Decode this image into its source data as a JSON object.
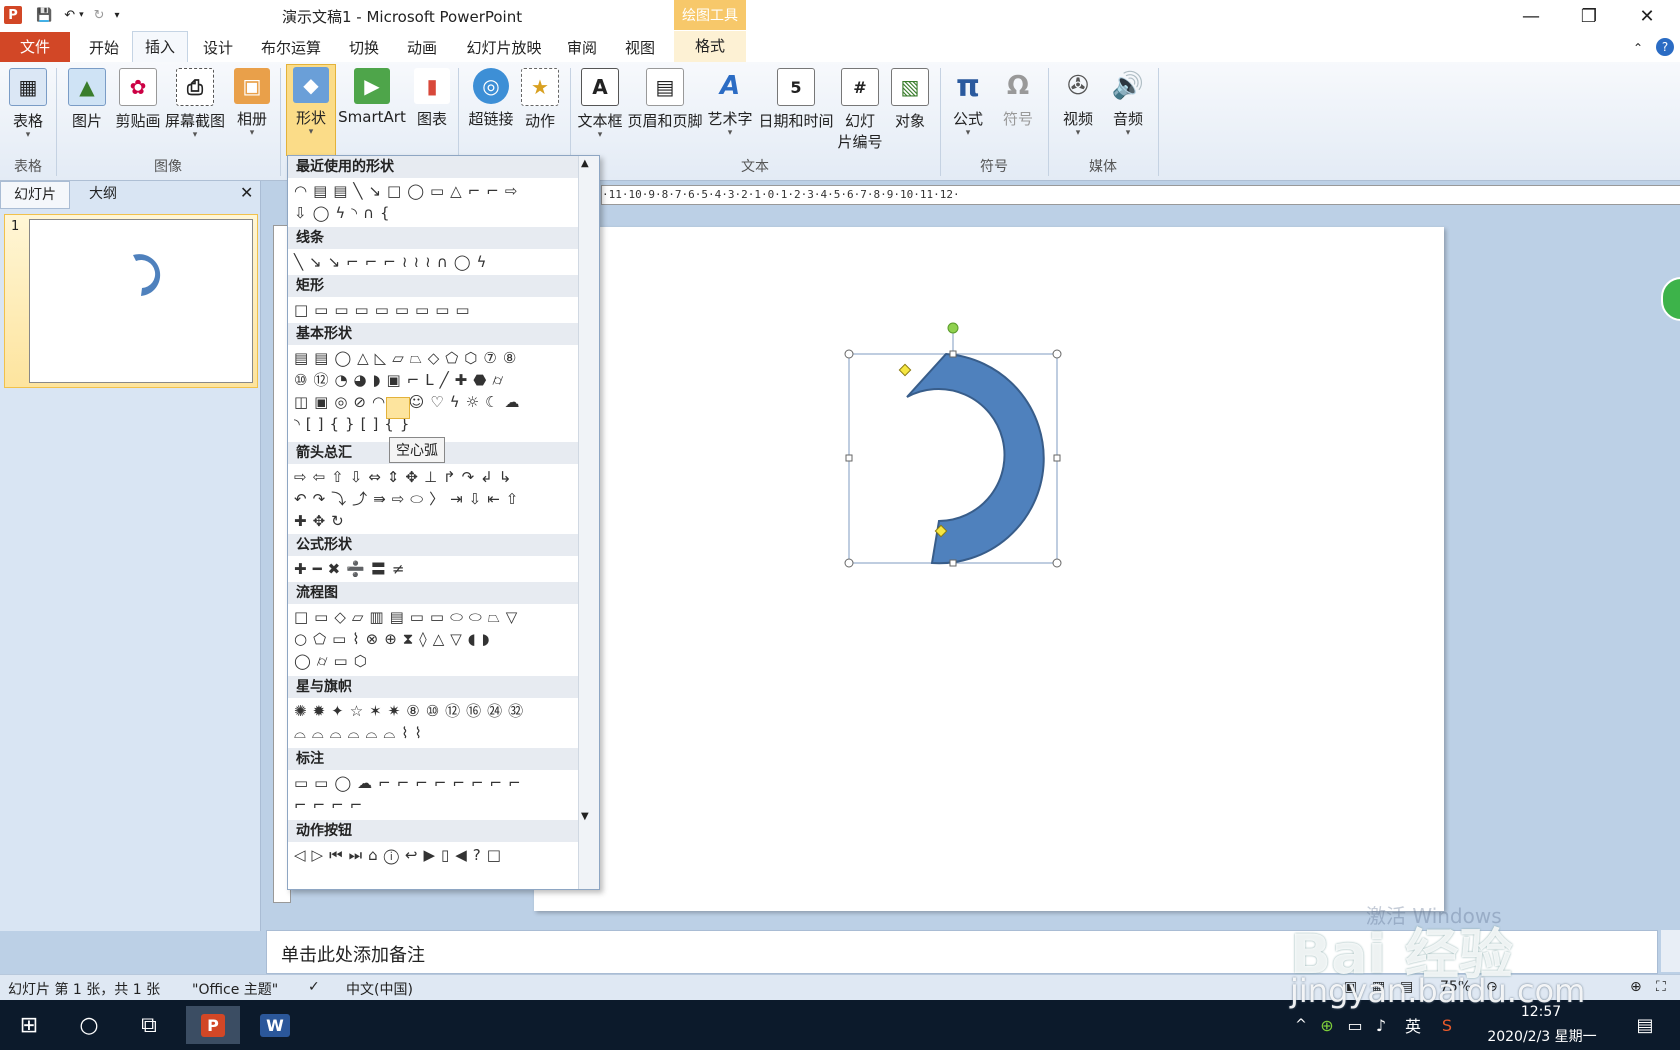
{
  "window": {
    "title": "演示文稿1 - Microsoft PowerPoint",
    "context_header": "绘图工具",
    "min": "—",
    "max": "❐",
    "close": "✕"
  },
  "tabs": [
    {
      "label": "文件"
    },
    {
      "label": "开始"
    },
    {
      "label": "插入"
    },
    {
      "label": "设计"
    },
    {
      "label": "布尔运算"
    },
    {
      "label": "切换"
    },
    {
      "label": "动画"
    },
    {
      "label": "幻灯片放映"
    },
    {
      "label": "审阅"
    },
    {
      "label": "视图"
    },
    {
      "label": "格式"
    }
  ],
  "ribbon": {
    "buttons": {
      "table": "表格",
      "picture": "图片",
      "clipart": "剪贴画",
      "screenshot": "屏幕截图",
      "album": "相册",
      "shapes": "形状",
      "smartart": "SmartArt",
      "chart": "图表",
      "hyperlink": "超链接",
      "action": "动作",
      "textbox": "文本框",
      "headerfooter": "页眉和页脚",
      "wordart": "艺术字",
      "datetime": "日期和时间",
      "slidenum_1": "幻灯",
      "slidenum_2": "片编号",
      "object": "对象",
      "equation": "公式",
      "symbol": "符号",
      "video": "视频",
      "audio": "音频"
    },
    "groups": {
      "tables": "表格",
      "images": "图像",
      "text": "文本",
      "symbols": "符号",
      "media": "媒体"
    }
  },
  "left_panel": {
    "tab_slides": "幻灯片",
    "tab_outline": "大纲",
    "slide_number": "1"
  },
  "ruler_text": "·11·10·9·8·7·6·5·4·3·2·1·0·1·2·3·4·5·6·7·8·9·10·11·12·",
  "shapes_panel": {
    "sections": {
      "recent": "最近使用的形状",
      "lines": "线条",
      "rectangles": "矩形",
      "basic": "基本形状",
      "arrows": "箭头总汇",
      "equation": "公式形状",
      "flowchart": "流程图",
      "stars": "星与旗帜",
      "callouts": "标注",
      "action_buttons": "动作按钮"
    },
    "tooltip": "空心弧"
  },
  "notes_placeholder": "单击此处添加备注",
  "status": {
    "slide_info": "幻灯片 第 1 张，共 1 张",
    "theme": "\"Office 主题\"",
    "language": "中文(中国)",
    "zoom": "75%"
  },
  "taskbar": {
    "time": "12:57",
    "date": "2020/2/3 星期一",
    "ime": "英"
  },
  "watermark": {
    "line1": "激活 Windows",
    "brand": "Bai 经验",
    "url": "jingyan.baidu.com"
  },
  "colors": {
    "file_tab": "#d24726",
    "shape_fill": "#4f81bd",
    "shape_stroke": "#385d8a"
  }
}
